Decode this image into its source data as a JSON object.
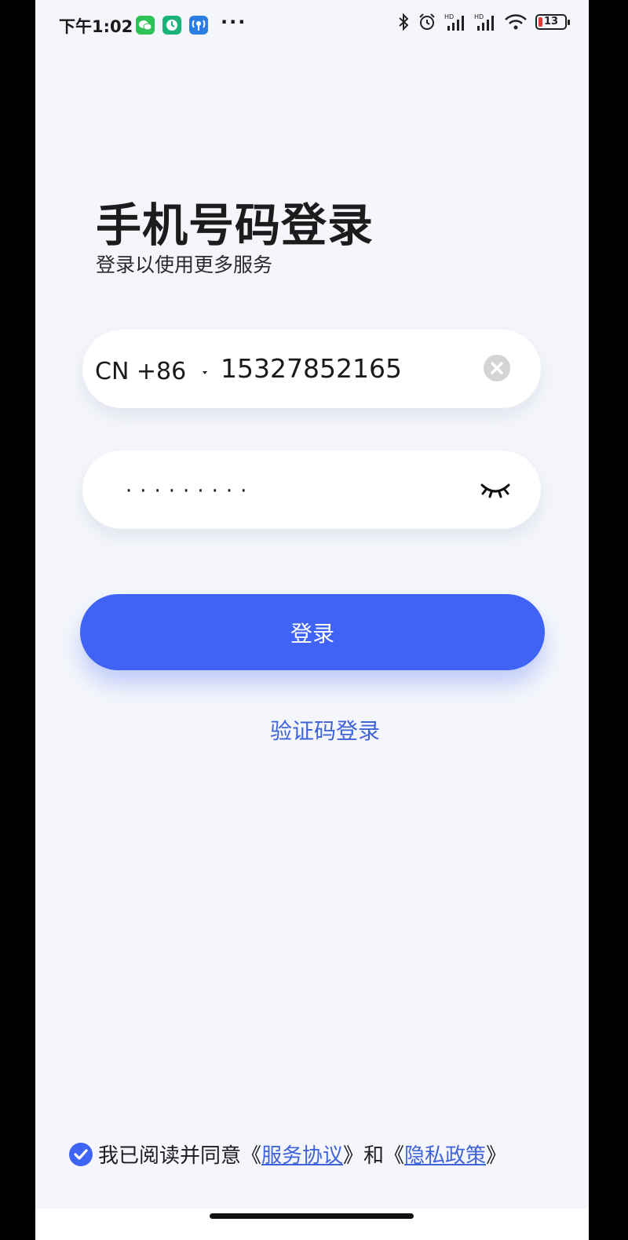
{
  "status_bar": {
    "time": "下午1:02",
    "apps": [
      "wechat-icon",
      "security-app-icon",
      "network-app-icon"
    ],
    "more": "···",
    "icons": [
      "bluetooth-icon",
      "alarm-icon",
      "hd-signal-icon",
      "hd-signal-icon",
      "wifi-icon"
    ],
    "network_label": "HD",
    "battery_level": "13",
    "battery_color": "#e53935"
  },
  "header": {
    "title": "手机号码登录",
    "subtitle": "登录以使用更多服务"
  },
  "phone_field": {
    "country_code": "CN +86",
    "value": "15327852165"
  },
  "password_field": {
    "value": "·········"
  },
  "actions": {
    "login_label": "登录",
    "sms_login_label": "验证码登录"
  },
  "agreement": {
    "prefix": "我已阅读并同意《",
    "service_link": "服务协议",
    "middle": "》和《",
    "privacy_link": "隐私政策",
    "suffix": "》",
    "checked": true
  },
  "colors": {
    "accent": "#3f63f5",
    "link": "#3f63d8",
    "background": "#f4f6fb"
  }
}
